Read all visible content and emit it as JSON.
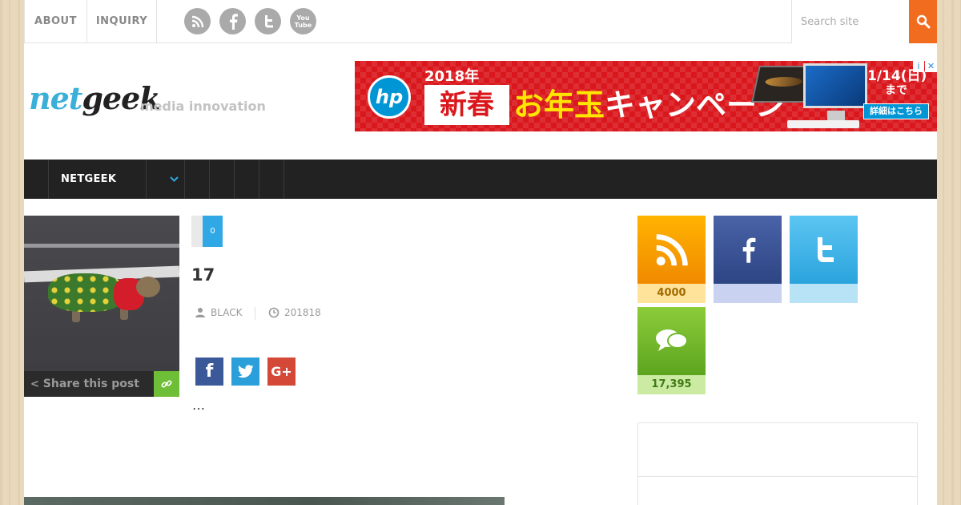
{
  "topbar": {
    "links": [
      {
        "label": "ABOUT"
      },
      {
        "label": "INQUIRY"
      }
    ],
    "social_icons": [
      "rss-icon",
      "facebook-icon",
      "twitter-icon",
      "youtube-icon"
    ],
    "youtube_text": "You\nTube",
    "search": {
      "placeholder": "Search site",
      "value": ""
    },
    "accent_color": "#f26c1f"
  },
  "header": {
    "logo_net": "net",
    "logo_geek": "geek",
    "tagline": "media innovation"
  },
  "ad": {
    "brand": "hp",
    "year": "2018年",
    "headline_box": "新春",
    "headline_yellow": "お年玉",
    "headline_white": "キャンペーン",
    "date": "1/14(日)",
    "date_suffix": "まで",
    "detail_button": "詳細はこちら",
    "info_icon": "i",
    "close_icon": "✕"
  },
  "nav": {
    "item": "NETGEEK",
    "dropdown_icon": "chevron-down-icon"
  },
  "post": {
    "comment_count": "0",
    "title": "17",
    "author": "BLACK",
    "date": "201818",
    "share_label": "Share this post",
    "excerpt": "…",
    "share_buttons": {
      "facebook": "f",
      "google": "G+"
    }
  },
  "sidebar": {
    "rss_count": "4000",
    "facebook_count": "",
    "twitter_count": "",
    "comments_count": "17,395"
  },
  "colors": {
    "rss": "#f08a00",
    "facebook": "#3b5998",
    "twitter": "#2b9fd9",
    "google": "#d34836",
    "comments": "#5da51f",
    "nav": "#222222"
  }
}
